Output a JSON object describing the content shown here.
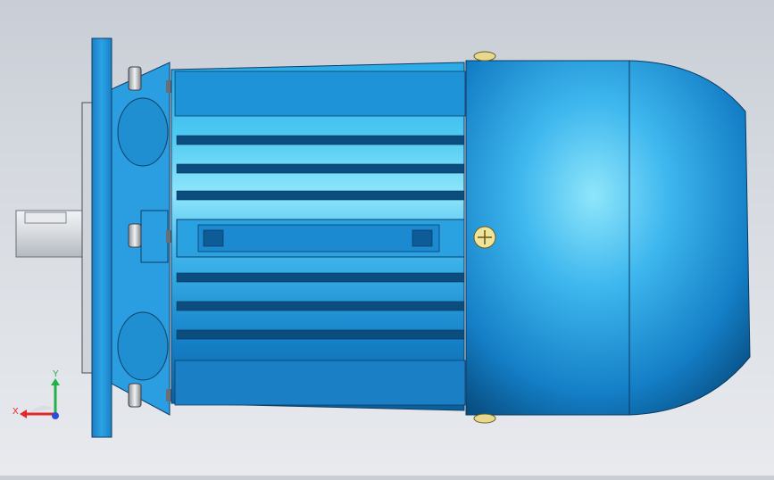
{
  "viewport": {
    "colors": {
      "body_light": "#5fd4f5",
      "body_mid": "#1a9ad8",
      "body_dark": "#0b5f9a",
      "flange": "#1c8fd6",
      "shaft": "#d6dadf",
      "screw_head": "#e6d88f",
      "background_top": "#c9ced6",
      "background_bottom": "#e8eaee"
    }
  },
  "triad": {
    "x_label": "X",
    "y_label": "Y",
    "z_label": "",
    "x_color": "#e0282a",
    "y_color": "#22b04b",
    "z_color": "#2a4fd8"
  }
}
